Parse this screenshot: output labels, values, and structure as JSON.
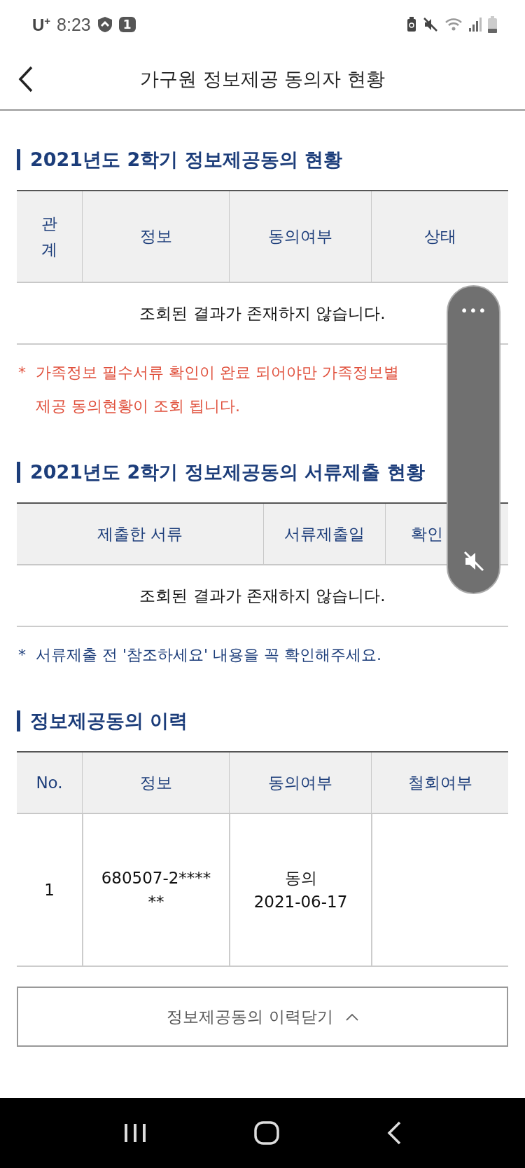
{
  "status_bar": {
    "carrier": "U",
    "carrier_mark": "+",
    "time": "8:23",
    "badge": "1"
  },
  "header": {
    "title": "가구원 정보제공 동의자 현황"
  },
  "sections": [
    {
      "title": "2021년도 2학기 정보제공동의 현황",
      "kind": "consent",
      "columns": [
        "관계",
        "정보",
        "동의여부",
        "상태"
      ],
      "empty": "조회된 결과가 존재하지 않습니다.",
      "note": {
        "kind": "warning",
        "marker": "*",
        "lines": [
          "가족정보 필수서류 확인이 완료 되어야만 가족정보별",
          "제공 동의현황이 조회 됩니다."
        ]
      }
    },
    {
      "title": "2021년도 2학기 정보제공동의 서류제출 현황",
      "kind": "docs",
      "columns": [
        "제출한 서류",
        "서류제출일",
        "확인"
      ],
      "empty": "조회된 결과가 존재하지 않습니다.",
      "note": {
        "kind": "info",
        "marker": "*",
        "lines": [
          "서류제출 전 '참조하세요' 내용을 꼭 확인해주세요."
        ]
      }
    },
    {
      "title": "정보제공동의 이력",
      "kind": "history",
      "columns": [
        "No.",
        "정보",
        "동의여부",
        "철회여부"
      ],
      "rows": [
        {
          "no": "1",
          "info": [
            "680507-2****",
            "**"
          ],
          "consent": [
            "동의",
            "2021-06-17"
          ],
          "withdrawn": ""
        }
      ]
    }
  ],
  "close_button": {
    "label": "정보제공동의 이력닫기",
    "expanded": true
  },
  "floating_widget": {
    "more": "•••",
    "muted": true
  }
}
